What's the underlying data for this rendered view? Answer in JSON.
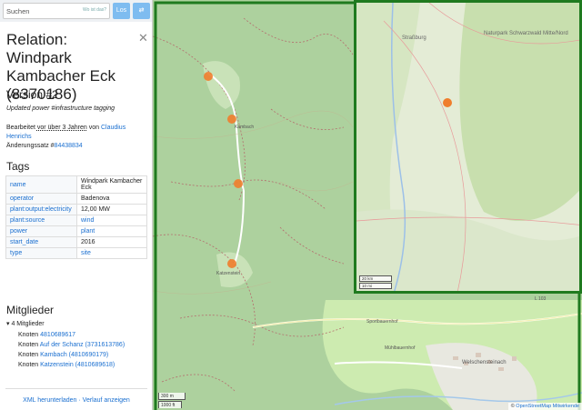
{
  "search": {
    "placeholder": "Suchen",
    "hint": "Wo ist das?",
    "go_label": "Los",
    "directions_label": "⇄"
  },
  "sidebar": {
    "title": "Relation: Windpark Kambacher Eck (8370186)",
    "version": "Version #2",
    "comment": "Updated power #infrastructure tagging",
    "edited_prefix": "Bearbeitet",
    "edited_ago": "vor über 3 Jahren",
    "edited_by": "von",
    "edited_user": "Claudius Henrichs",
    "changeset_label": "Änderungssatz #",
    "changeset_id": "84438834",
    "tags_heading": "Tags",
    "tags": [
      {
        "key": "name",
        "value": "Windpark Kambacher Eck",
        "link": false
      },
      {
        "key": "operator",
        "value": "Badenova",
        "link": false
      },
      {
        "key": "plant:output:electricity",
        "value": "12,00 MW",
        "link": false
      },
      {
        "key": "plant:source",
        "value": "wind",
        "link": true
      },
      {
        "key": "power",
        "value": "plant",
        "link": true
      },
      {
        "key": "start_date",
        "value": "2016",
        "link": false
      },
      {
        "key": "type",
        "value": "site",
        "link": true
      }
    ],
    "members_heading": "Mitglieder",
    "members_summary": "▾ 4 Mitglieder",
    "members": [
      {
        "type": "Knoten",
        "name": "4810689617"
      },
      {
        "type": "Knoten",
        "name": "Auf der Schanz (3731613786)"
      },
      {
        "type": "Knoten",
        "name": "Kambach (4810690179)"
      },
      {
        "type": "Knoten",
        "name": "Katzenstein (4810689618)"
      }
    ],
    "footer": "XML herunterladen · Verlauf anzeigen"
  },
  "map": {
    "scale_metric": "300 m",
    "scale_imperial": "1000 ft",
    "mini_scale_metric": "20 km",
    "mini_scale_imperial": "10 mi",
    "attribution_prefix": "© ",
    "attribution_link": "OpenStreetMap Mitwirkende",
    "labels": {
      "road": "L 103",
      "village": "Welschensteinach",
      "place1": "Mühlbauernhof",
      "place2": "Sportbauernhof",
      "place3": "Katzenstein",
      "place4": "Kambach",
      "mini_park": "Naturpark Schwarzwald Mitte/Nord",
      "mini_city": "Straßburg"
    },
    "colors": {
      "forest": "#add19e",
      "meadow": "#cdebb0",
      "marker": "#ef7d2c",
      "frame": "#1f7a1f",
      "link": "#1a6fd0"
    }
  }
}
